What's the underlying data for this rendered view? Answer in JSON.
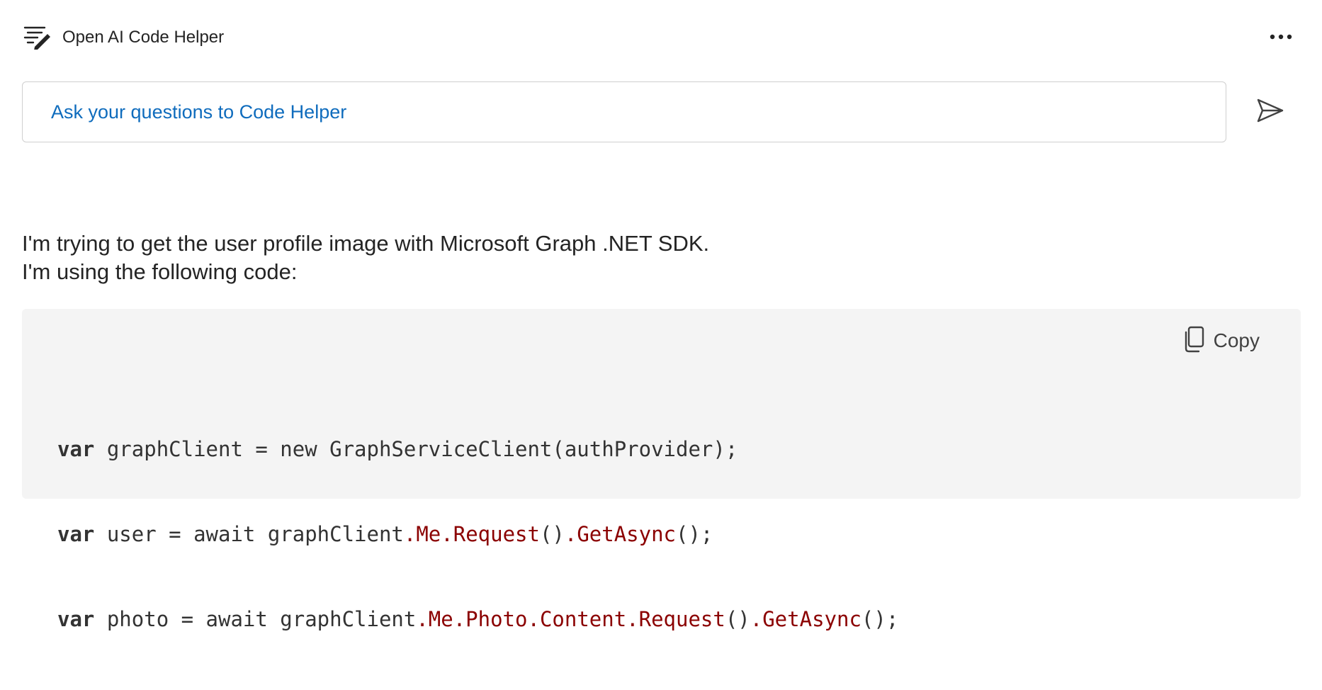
{
  "header": {
    "app_icon": "notes-pen-icon",
    "title": "Open AI Code Helper",
    "more_icon": "more-horizontal-icon"
  },
  "ask": {
    "placeholder": "Ask your questions to Code Helper",
    "value": "",
    "send_icon": "send-icon"
  },
  "message": {
    "lines": [
      "I'm trying to get the user profile image with Microsoft Graph .NET SDK.",
      "I'm using the following code:"
    ]
  },
  "code_block": {
    "copy_icon": "copy-icon",
    "copy_label": "Copy",
    "lines": [
      [
        {
          "t": "var",
          "c": "kw"
        },
        {
          "t": " graphClient = new GraphServiceClient(authProvider);",
          "c": ""
        }
      ],
      [
        {
          "t": "var",
          "c": "kw"
        },
        {
          "t": " user = await graphClient",
          "c": ""
        },
        {
          "t": ".Me.Request",
          "c": "mem"
        },
        {
          "t": "()",
          "c": ""
        },
        {
          "t": ".GetAsync",
          "c": "mem"
        },
        {
          "t": "();",
          "c": ""
        }
      ],
      [
        {
          "t": "var",
          "c": "kw"
        },
        {
          "t": " photo = await graphClient",
          "c": ""
        },
        {
          "t": ".Me.Photo.Content.Request",
          "c": "mem"
        },
        {
          "t": "()",
          "c": ""
        },
        {
          "t": ".GetAsync",
          "c": "mem"
        },
        {
          "t": "();",
          "c": ""
        }
      ]
    ]
  },
  "colors": {
    "placeholder": "#0f6cbd",
    "code_member": "#8b0000",
    "code_background": "#f4f4f4",
    "text": "#242424"
  }
}
